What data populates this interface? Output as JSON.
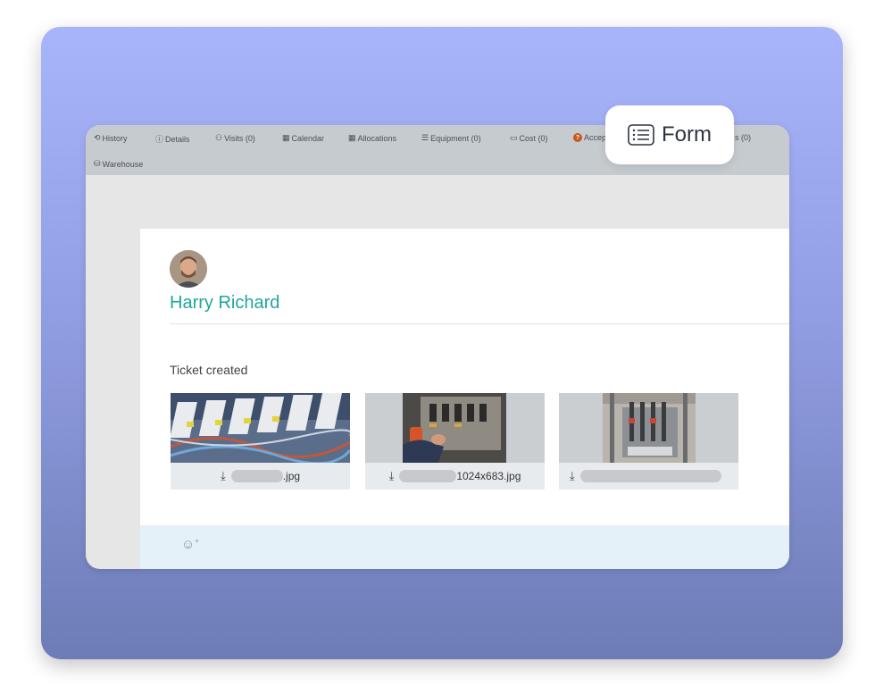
{
  "tabs": [
    {
      "id": "history",
      "label": "History",
      "icon": "history-icon",
      "glyph": "⟲"
    },
    {
      "id": "details",
      "label": "Details",
      "icon": "info-icon",
      "glyph": "ⓘ"
    },
    {
      "id": "visits",
      "label": "Visits (0)",
      "icon": "visits-icon",
      "glyph": "⚇"
    },
    {
      "id": "calendar",
      "label": "Calendar",
      "icon": "calendar-icon",
      "glyph": "▦"
    },
    {
      "id": "allocations",
      "label": "Allocations",
      "icon": "allocations-icon",
      "glyph": "▦"
    },
    {
      "id": "equipment",
      "label": "Equipment (0)",
      "icon": "equipment-icon",
      "glyph": "☰"
    },
    {
      "id": "cost",
      "label": "Cost (0)",
      "icon": "cost-icon",
      "glyph": "▭"
    },
    {
      "id": "accept",
      "label": "Accep",
      "icon": "question-icon",
      "glyph": "?"
    },
    {
      "id": "partial",
      "label": "s (0)",
      "icon": "",
      "glyph": ""
    },
    {
      "id": "warehouse",
      "label": "Warehouse",
      "icon": "warehouse-icon",
      "glyph": "⛁"
    }
  ],
  "form_chip": {
    "label": "Form",
    "icon": "list-icon"
  },
  "ticket": {
    "author_name": "Harry Richard",
    "event": "Ticket created",
    "attachments": [
      {
        "filename_suffix": ".jpg",
        "icon": "download-icon"
      },
      {
        "filename_suffix": "1024x683.jpg",
        "icon": "download-icon"
      },
      {
        "filename_suffix": "",
        "icon": "download-icon"
      }
    ]
  },
  "footer": {
    "icon": "add-reaction-icon",
    "glyph": "☺"
  },
  "colors": {
    "accent": "#1ea79b",
    "tabbar": "#c6cbcf",
    "footer": "#e5f1f9"
  }
}
